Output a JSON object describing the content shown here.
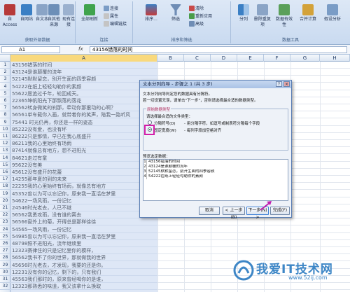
{
  "ribbon": {
    "groups": [
      {
        "label": "获取外部数据",
        "buttons": [
          "自 Access",
          "自网站",
          "自文本",
          "自其他来源",
          "现有连接"
        ]
      },
      {
        "label": "连接",
        "buttons": [
          "全部刷新",
          "连接",
          "属性",
          "编辑链接"
        ]
      },
      {
        "label": "排序和筛选",
        "buttons": [
          "排序...",
          "筛选",
          "清除",
          "重新应用",
          "高级"
        ]
      },
      {
        "label": "数据工具",
        "buttons": [
          "分列",
          "删除重复项",
          "数据有效性",
          "合并计算",
          "假设分析"
        ]
      }
    ]
  },
  "formula_bar": {
    "name_box": "A1",
    "fx": "fx",
    "formula": "43156错落的时间"
  },
  "columns": [
    "A",
    "B",
    "C",
    "D",
    "E",
    "F",
    "G",
    "H"
  ],
  "rows": [
    "43156错落的时间",
    "43124是谁颠覆的流年",
    "52145默默留恋，别开生面的四季容颜",
    "54222在纸上轻轻勾勒你的素颜",
    "55622愿追过千年，轮回成天。",
    "22365坤帆阳光下那飘落的落花",
    "56562转身微笑的刹那，牵动你那狠动的心啊？",
    "56561单车载你入画，就带着你的笑声，陪我一路听风",
    "75441 时光仍再，你还是一样的姿态",
    "85222没有爱，也没有坏",
    "86222只是那情，早已在我心底盛开",
    "86211我的心里始终有场雨",
    "87414就像总有地方，想不进阳光",
    "84621走过有童",
    "95622没有美",
    "45612没有盛开的花蕾",
    "14255那年夏的到的未来",
    "22255我的心里始终有场雨，就像总有地方",
    "45352曾以为可以忘记你，原来我一直活在梦里",
    "54622一场风雨，一份记忆",
    "24546时光老去，人已不继",
    "56562我勇攻雨，没有谁的离去",
    "56566窗外上的菊，开得总是那样徐徐",
    "54565一场风雨，一份记忆",
    "54985曾以为可以忘记你，原来我一直活在梦里",
    "48798照不进阳光，流年继续里",
    "12323赛律住的只是记忆里你的模样，",
    "56562我书不了你的世界，那就做我的世界",
    "45656时光老去，才发现，我要的还是你。",
    "12231没有你的记忆，剩下的，只有我们",
    "45563我们那时的，原来曾经喝你的是谁，",
    "12323那熟悉的味道，我又该拿什么换取"
  ],
  "dialog": {
    "title": "文本分列向导 - 步骤之 1 (共 3 步)",
    "line1": "文本分列向导判定您的数据具有分隔符。",
    "line2": "若一切设置无误，请单击\"下一步\"，否则请选择最合适的数据类型。",
    "group_label": "原始数据类型",
    "group_prompt": "请选择最合适的文件类型：",
    "option_delimited": "分隔符号(D)",
    "option_delimited_desc": "- 用分隔字符，如逗号或制表符分隔每个字段",
    "option_fixed": "固定宽度(W)",
    "option_fixed_desc": "- 每列字段加空格对齐",
    "selected_option": "固定宽度(W)",
    "preview_label": "预览选定数据：",
    "preview_rows": [
      {
        "n": "1",
        "text": "43156错落的时间"
      },
      {
        "n": "2",
        "text": "43124是谁颠覆的流年"
      },
      {
        "n": "3",
        "text": "52145默默留恋，别开生面的四季容颜"
      },
      {
        "n": "4",
        "text": "54222在纸上轻轻勾勒你的素颜"
      }
    ],
    "buttons": {
      "cancel": "取消",
      "back": "< 上一步(B)",
      "next": "下一步(N) >",
      "finish": "完成(F)"
    }
  },
  "watermark": {
    "text": "我爱IT技术网",
    "url": "www.52ij.com"
  },
  "colors": {
    "highlight": "#d21ea8",
    "arrow": "#c020b0",
    "watermark": "#3d86c6"
  }
}
